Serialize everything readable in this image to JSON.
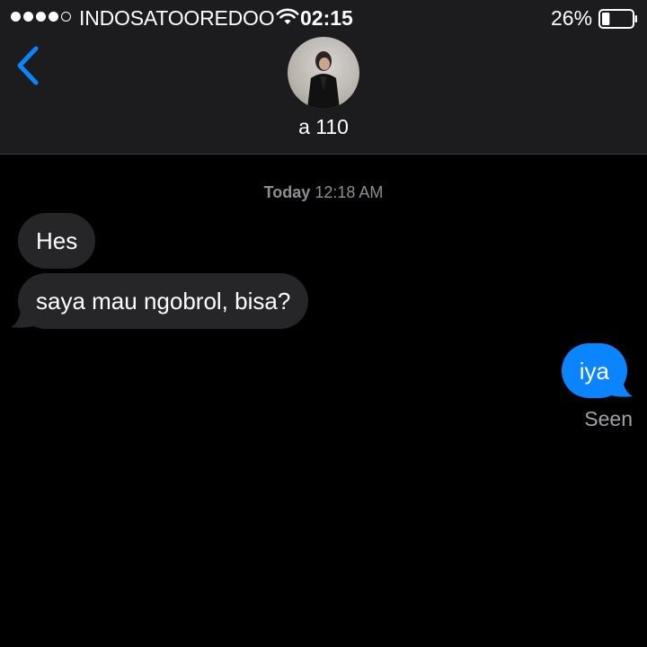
{
  "status_bar": {
    "signal_dots_filled": 4,
    "signal_dots_total": 5,
    "carrier": "INDOSATOOREDOO",
    "time": "02:15",
    "battery_percent": "26%",
    "battery_level": 0.26
  },
  "header": {
    "back_icon": "chevron-left-icon",
    "contact_name": "a 110"
  },
  "conversation": {
    "timestamp_day": "Today",
    "timestamp_time": "12:18 AM",
    "messages": [
      {
        "direction": "incoming",
        "text": "Hes"
      },
      {
        "direction": "incoming",
        "text": "saya mau ngobrol, bisa?"
      },
      {
        "direction": "outgoing",
        "text": "iya"
      }
    ],
    "read_receipt": "Seen"
  },
  "colors": {
    "background": "#000000",
    "header_background": "#1c1c1e",
    "incoming_bubble": "#262628",
    "outgoing_bubble": "#0a84ff",
    "accent": "#0a84ff",
    "secondary_text": "#8e8e93"
  }
}
